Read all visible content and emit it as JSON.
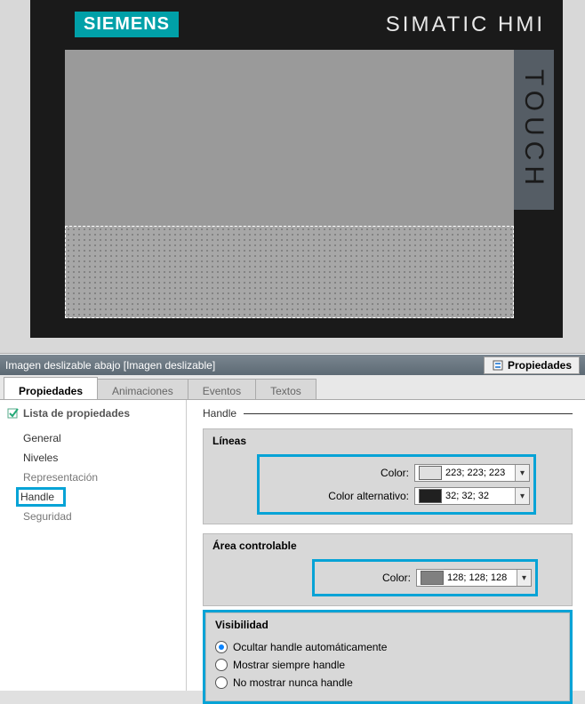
{
  "hmi": {
    "brand": "SIEMENS",
    "product": "SIMATIC HMI",
    "touch": "TOUCH"
  },
  "context_bar": {
    "title": "Imagen deslizable abajo [Imagen deslizable]",
    "tab": "Propiedades"
  },
  "main_tabs": [
    "Propiedades",
    "Animaciones",
    "Eventos",
    "Textos"
  ],
  "sidebar": {
    "header": "Lista de propiedades",
    "items": [
      "General",
      "Niveles",
      "Representación",
      "Handle",
      "Seguridad"
    ],
    "selected": "Handle"
  },
  "handle": {
    "title": "Handle",
    "lineas": {
      "title": "Líneas",
      "color_label": "Color:",
      "color_value": "223; 223; 223",
      "color_swatch": "#dfdfdf",
      "alt_label": "Color alternativo:",
      "alt_value": "32; 32; 32",
      "alt_swatch": "#202020"
    },
    "area": {
      "title": "Área controlable",
      "color_label": "Color:",
      "color_value": "128; 128; 128",
      "color_swatch": "#808080"
    },
    "visibilidad": {
      "title": "Visibilidad",
      "options": [
        {
          "label": "Ocultar handle automáticamente",
          "checked": true
        },
        {
          "label": "Mostrar siempre handle",
          "checked": false
        },
        {
          "label": "No mostrar nunca handle",
          "checked": false
        }
      ]
    }
  }
}
